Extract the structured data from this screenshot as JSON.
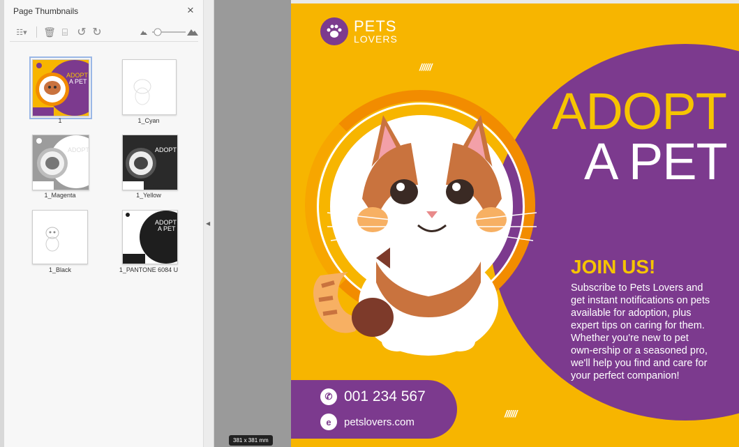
{
  "sidebar": {
    "title": "Page Thumbnails",
    "close_icon": "×",
    "toolbar": {
      "options_icon": "☷▾",
      "delete_icon": "🗑",
      "insert_icon": "⌸",
      "rotate_left_icon": "↺",
      "rotate_right_icon": "↻"
    },
    "thumbnails": [
      {
        "label": "1"
      },
      {
        "label": "1_Cyan"
      },
      {
        "label": "1_Magenta"
      },
      {
        "label": "1_Yellow"
      },
      {
        "label": "1_Black"
      },
      {
        "label": "1_PANTONE 6084 U"
      }
    ]
  },
  "document": {
    "dimensions": "381 x 381 mm"
  },
  "poster": {
    "brand_line1": "PETS",
    "brand_line2": "LOVERS",
    "hashes": "//////",
    "headline1": "ADOPT",
    "headline2": "A PET",
    "join": "JOIN US!",
    "paragraph": "Subscribe to Pets Lovers and get instant notifications on pets available for adoption, plus expert tips on caring for them. Whether you're new to pet own-ership or a seasoned pro, we'll help you find and care for your perfect companion!",
    "phone": "001 234 567",
    "website": "petslovers.com",
    "colors": {
      "yellow": "#f7b500",
      "purple": "#7c3a8e",
      "orange": "#f28c00"
    }
  }
}
